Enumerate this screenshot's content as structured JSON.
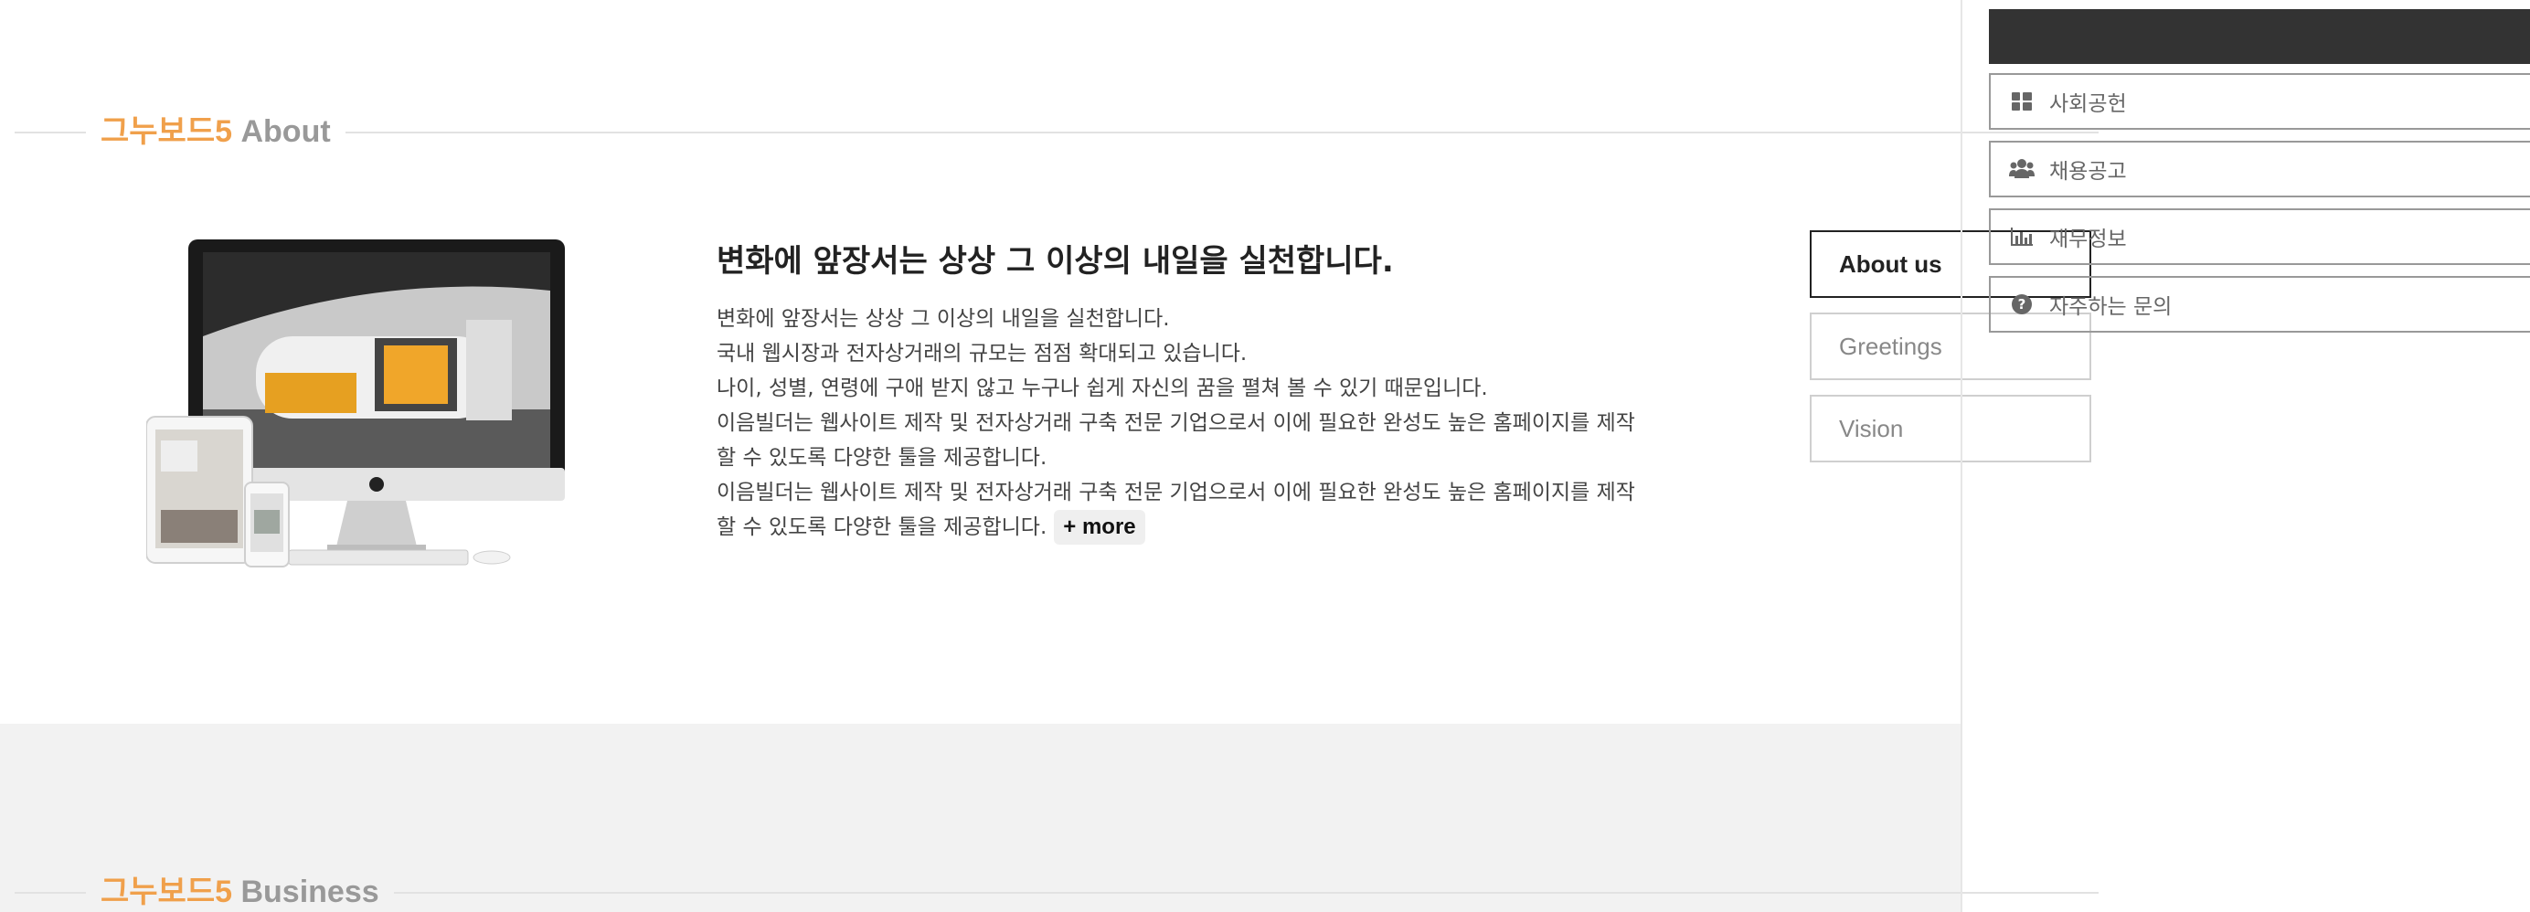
{
  "sections": {
    "about": {
      "brand": "그누보드5",
      "word": "About"
    },
    "business": {
      "brand": "그누보드5",
      "word": "Business"
    }
  },
  "about": {
    "heading": "변화에 앞장서는 상상 그 이상의 내일을 실천합니다.",
    "paragraphs": [
      "변화에 앞장서는 상상 그 이상의 내일을 실천합니다.",
      "국내 웹시장과 전자상거래의 규모는 점점 확대되고 있습니다.",
      "나이, 성별, 연령에 구애 받지 않고 누구나 쉽게 자신의 꿈을 펼쳐 볼 수 있기 때문입니다.",
      "이음빌더는 웹사이트 제작 및 전자상거래 구축 전문 기업으로서 이에 필요한 완성도 높은 홈페이지를 제작할 수 있도록 다양한 툴을 제공합니다.",
      "이음빌더는 웹사이트 제작 및 전자상거래 구축 전문 기업으로서 이에 필요한 완성도 높은 홈페이지를 제작할 수 있도록 다양한 툴을 제공합니다."
    ],
    "more_label": "+ more"
  },
  "about_tabs": [
    "About us",
    "Greetings",
    "Vision"
  ],
  "quick_menu": [
    {
      "icon": "grid-icon",
      "label": "사회공헌"
    },
    {
      "icon": "users-icon",
      "label": "채용공고"
    },
    {
      "icon": "bar-chart-icon",
      "label": "재무정보"
    },
    {
      "icon": "question-circle-icon",
      "label": "자주하는 문의"
    }
  ],
  "colors": {
    "brand_orange": "#f0a04b",
    "heading_grey": "#999999",
    "dark_bar": "#333333",
    "band_grey": "#f2f2f2"
  }
}
